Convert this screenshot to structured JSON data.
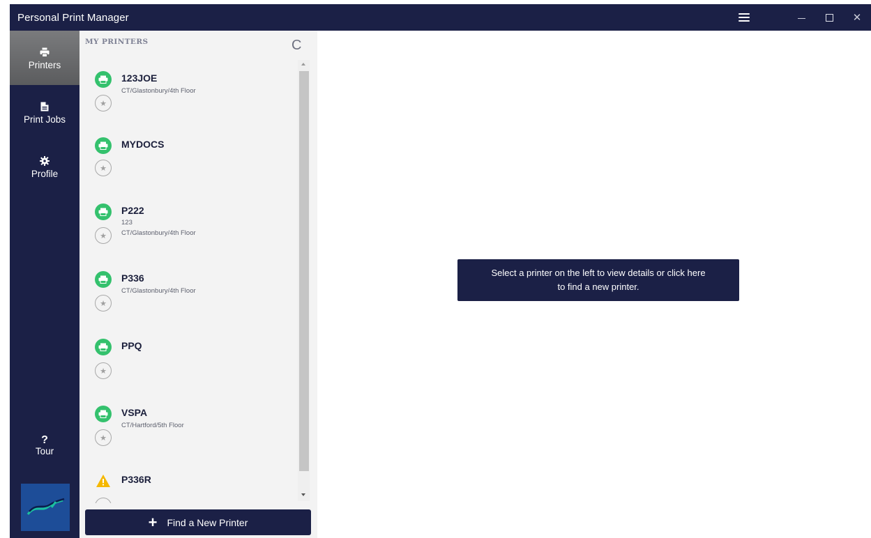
{
  "window": {
    "title": "Personal Print Manager",
    "controls": {
      "menu_icon": "hamburger-icon",
      "minimize_icon": "minimize-icon",
      "maximize_icon": "maximize-icon",
      "close_icon": "close-icon",
      "close_glyph": "✕"
    }
  },
  "nav": {
    "items": [
      {
        "label": "Printers",
        "icon": "printer-icon",
        "active": true
      },
      {
        "label": "Print Jobs",
        "icon": "document-icon",
        "active": false
      },
      {
        "label": "Profile",
        "icon": "gear-icon",
        "active": false
      }
    ],
    "tour": {
      "glyph": "?",
      "label": "Tour",
      "icon": "question-icon"
    },
    "logo_icon": "brand-logo-icon"
  },
  "panel": {
    "header": "MY PRINTERS",
    "refresh_glyph": "C",
    "printers": [
      {
        "name": "123JOE",
        "lines": [
          "CT/Glastonbury/4th Floor"
        ],
        "status": "ok"
      },
      {
        "name": "MYDOCS",
        "lines": [],
        "status": "ok"
      },
      {
        "name": "P222",
        "lines": [
          "123",
          "CT/Glastonbury/4th Floor"
        ],
        "status": "ok"
      },
      {
        "name": "P336",
        "lines": [
          "CT/Glastonbury/4th Floor"
        ],
        "status": "ok"
      },
      {
        "name": "PPQ",
        "lines": [],
        "status": "ok"
      },
      {
        "name": "VSPA",
        "lines": [
          "CT/Hartford/5th Floor"
        ],
        "status": "ok"
      },
      {
        "name": "P336R",
        "lines": [],
        "status": "warning"
      }
    ],
    "star_glyph": "★",
    "find_button": {
      "plus": "+",
      "label": "Find a New Printer"
    }
  },
  "main": {
    "hint_line1": "Select a printer on the left to view details or click here",
    "hint_line2": "to find a new printer."
  },
  "colors": {
    "navy": "#1b2046",
    "status_ok": "#34c16d",
    "status_warning": "#f5b800",
    "active_nav": "#6b6c6e"
  }
}
